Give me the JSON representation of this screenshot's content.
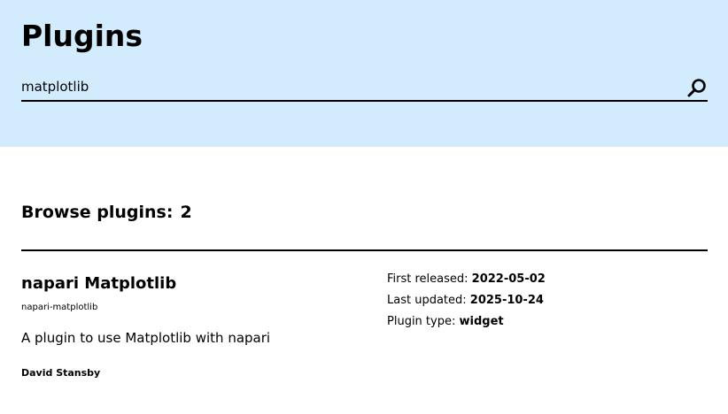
{
  "header": {
    "title": "Plugins",
    "background_color": "#d2ecfe"
  },
  "search": {
    "value": "matplotlib",
    "placeholder": "",
    "button_icon": "search-icon"
  },
  "browse": {
    "label": "Browse plugins:",
    "count": "2"
  },
  "results": [
    {
      "name": "napari Matplotlib",
      "slug": "napari-matplotlib",
      "summary": "A plugin to use Matplotlib with napari",
      "author": "David Stansby",
      "meta": {
        "first_released_label": "First released:",
        "first_released": "2022-05-02",
        "last_updated_label": "Last updated:",
        "last_updated": "2025-10-24",
        "plugin_type_label": "Plugin type:",
        "plugin_type": "widget"
      }
    }
  ]
}
